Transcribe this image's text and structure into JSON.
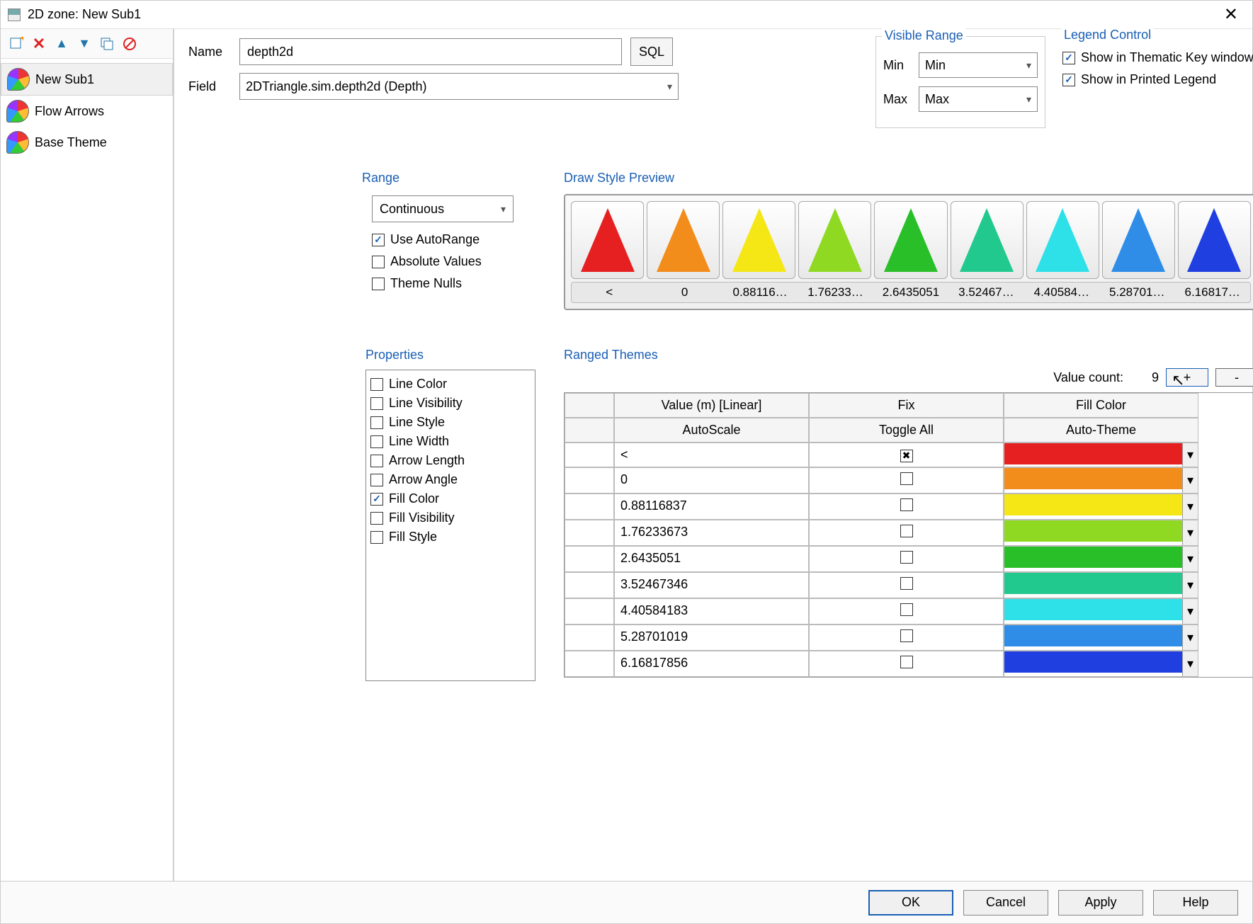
{
  "window": {
    "title": "2D zone: New Sub1"
  },
  "sidebar": {
    "items": [
      {
        "label": "New Sub1",
        "selected": true
      },
      {
        "label": "Flow Arrows",
        "selected": false
      },
      {
        "label": "Base Theme",
        "selected": false
      }
    ]
  },
  "form": {
    "name_label": "Name",
    "name_value": "depth2d",
    "sql_label": "SQL",
    "field_label": "Field",
    "field_value": "2DTriangle.sim.depth2d (Depth)"
  },
  "visible_range": {
    "title": "Visible Range",
    "min_label": "Min",
    "min_value": "Min",
    "max_label": "Max",
    "max_value": "Max"
  },
  "legend": {
    "title": "Legend Control",
    "thematic": "Show in Thematic Key window",
    "printed": "Show in Printed Legend"
  },
  "range": {
    "title": "Range",
    "type": "Continuous",
    "use_autorange": "Use AutoRange",
    "absolute": "Absolute Values",
    "theme_nulls": "Theme Nulls"
  },
  "draw_style": {
    "title": "Draw Style Preview",
    "colors": [
      "#e62020",
      "#f28c1a",
      "#f5e615",
      "#8fd923",
      "#29bf29",
      "#22c98f",
      "#2ee0e8",
      "#2f8de8",
      "#1f3fe0"
    ],
    "labels": [
      "<",
      "0",
      "0.88116…",
      "1.76233…",
      "2.6435051",
      "3.52467…",
      "4.40584…",
      "5.28701…",
      "6.16817…"
    ]
  },
  "properties": {
    "title": "Properties",
    "items": [
      {
        "label": "Line Color",
        "checked": false
      },
      {
        "label": "Line Visibility",
        "checked": false
      },
      {
        "label": "Line Style",
        "checked": false
      },
      {
        "label": "Line Width",
        "checked": false
      },
      {
        "label": "Arrow Length",
        "checked": false
      },
      {
        "label": "Arrow Angle",
        "checked": false
      },
      {
        "label": "Fill Color",
        "checked": true
      },
      {
        "label": "Fill Visibility",
        "checked": false
      },
      {
        "label": "Fill Style",
        "checked": false
      }
    ]
  },
  "ranged": {
    "title": "Ranged Themes",
    "value_count_label": "Value count:",
    "value_count": "9",
    "plus": "+",
    "minus": "-",
    "headers": {
      "value": "Value (m) [Linear]",
      "fix": "Fix",
      "fill": "Fill Color"
    },
    "subheaders": {
      "autoscale": "AutoScale",
      "toggle": "Toggle All",
      "autotheme": "Auto-Theme"
    },
    "rows": [
      {
        "value": "<",
        "fix": true,
        "color": "#e62020"
      },
      {
        "value": "0",
        "fix": false,
        "color": "#f28c1a"
      },
      {
        "value": "0.88116837",
        "fix": false,
        "color": "#f5e615"
      },
      {
        "value": "1.76233673",
        "fix": false,
        "color": "#8fd923"
      },
      {
        "value": "2.6435051",
        "fix": false,
        "color": "#29bf29"
      },
      {
        "value": "3.52467346",
        "fix": false,
        "color": "#22c98f"
      },
      {
        "value": "4.40584183",
        "fix": false,
        "color": "#2ee0e8"
      },
      {
        "value": "5.28701019",
        "fix": false,
        "color": "#2f8de8"
      },
      {
        "value": "6.16817856",
        "fix": false,
        "color": "#1f3fe0"
      }
    ]
  },
  "footer": {
    "ok": "OK",
    "cancel": "Cancel",
    "apply": "Apply",
    "help": "Help"
  }
}
